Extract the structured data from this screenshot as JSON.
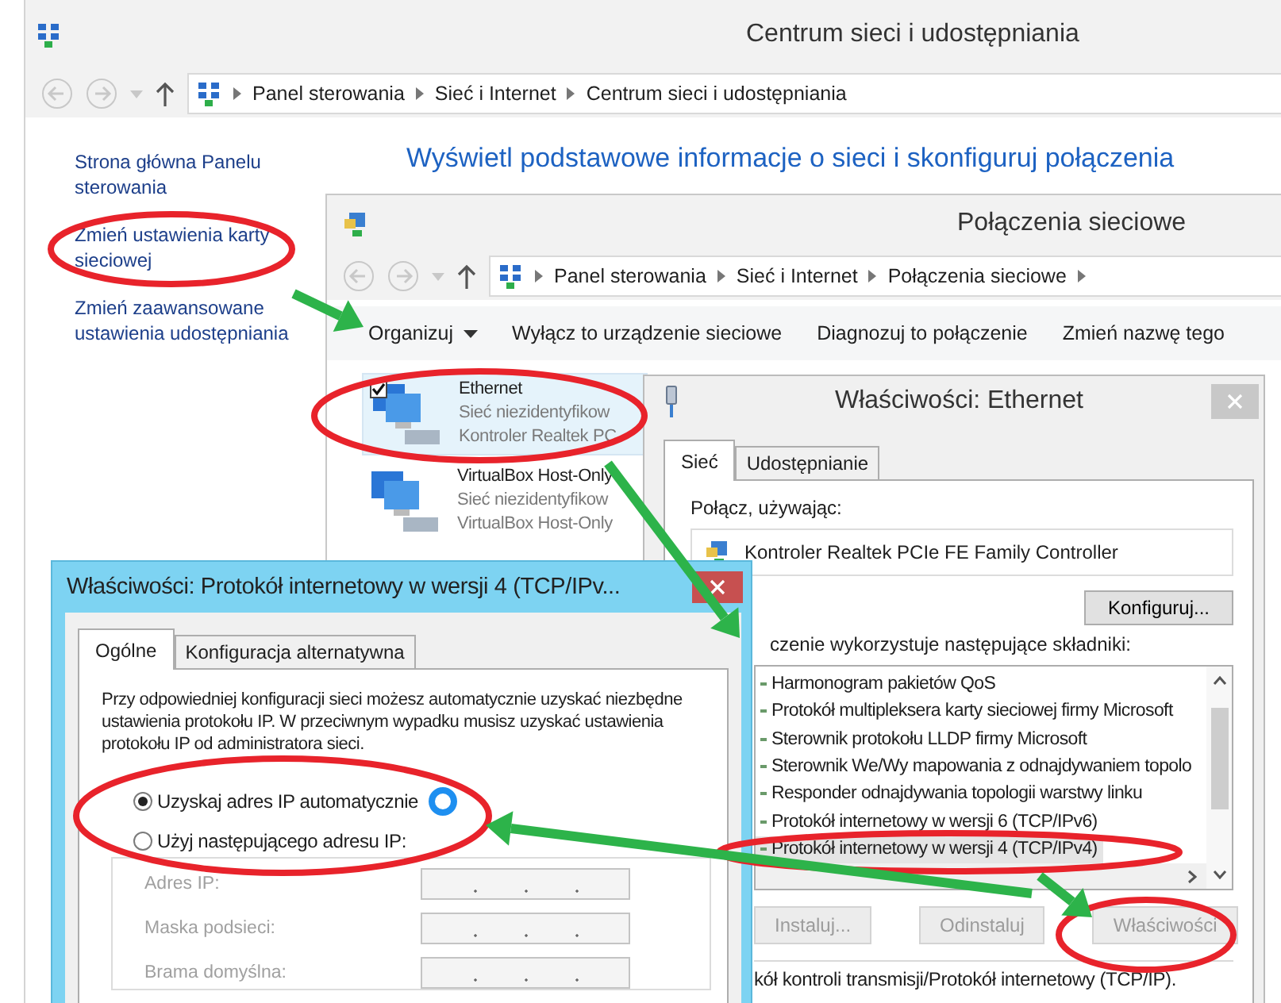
{
  "main_window": {
    "title": "Centrum sieci i udostępniania",
    "breadcrumb": [
      "Panel sterowania",
      "Sieć i Internet",
      "Centrum sieci i udostępniania"
    ],
    "sidebar": {
      "items": [
        {
          "label": "Strona główna Panelu sterowania"
        },
        {
          "label": "Zmień ustawienia karty sieciowej"
        },
        {
          "label": "Zmień zaawansowane ustawienia udostępniania"
        }
      ]
    },
    "heading": "Wyświetl podstawowe informacje o sieci i skonfiguruj połączenia"
  },
  "connections_window": {
    "title": "Połączenia sieciowe",
    "breadcrumb": [
      "Panel sterowania",
      "Sieć i Internet",
      "Połączenia sieciowe"
    ],
    "toolbar": [
      {
        "label": "Organizuj",
        "dropdown": true
      },
      {
        "label": "Wyłącz to urządzenie sieciowe",
        "dropdown": false
      },
      {
        "label": "Diagnozuj to połączenie",
        "dropdown": false
      },
      {
        "label": "Zmień nazwę tego",
        "dropdown": false
      }
    ],
    "connections": [
      {
        "name": "Ethernet",
        "status": "Sieć niezidentyfikow",
        "device": "Kontroler Realtek PC",
        "selected": true,
        "checked": true
      },
      {
        "name": "VirtualBox Host-Only",
        "status": "Sieć niezidentyfikow",
        "device": "VirtualBox Host-Only",
        "selected": false,
        "checked": false
      }
    ]
  },
  "ethernet_window": {
    "title": "Właściwości: Ethernet",
    "tabs": [
      {
        "label": "Sieć",
        "selected": true
      },
      {
        "label": "Udostępnianie",
        "selected": false
      }
    ],
    "connect_using_label": "Połącz, używając:",
    "adapter": "Kontroler Realtek PCIe FE Family Controller",
    "configure_button": "Konfiguruj...",
    "components_label": "czenie wykorzystuje następujące składniki:",
    "components": [
      {
        "name": "Harmonogram pakietów QoS",
        "selected": false
      },
      {
        "name": "Protokół multipleksera karty sieciowej firmy Microsoft",
        "selected": false
      },
      {
        "name": "Sterownik protokołu LLDP firmy Microsoft",
        "selected": false
      },
      {
        "name": "Sterownik We/Wy mapowania z odnajdywaniem topolo",
        "selected": false
      },
      {
        "name": "Responder odnajdywania topologii warstwy linku",
        "selected": false
      },
      {
        "name": "Protokół internetowy w wersji 6 (TCP/IPv6)",
        "selected": false
      },
      {
        "name": "Protokół internetowy w wersji 4 (TCP/IPv4)",
        "selected": true
      }
    ],
    "buttons": [
      {
        "label": "Instaluj...",
        "disabled": true
      },
      {
        "label": "Odinstaluj",
        "disabled": true
      },
      {
        "label": "Właściwości",
        "disabled": true
      }
    ],
    "description": "kół kontroli transmisji/Protokół internetowy (TCP/IP)."
  },
  "ip_window": {
    "title": "Właściwości: Protokół internetowy w wersji 4 (TCP/IPv...",
    "tabs": [
      {
        "label": "Ogólne",
        "selected": true
      },
      {
        "label": "Konfiguracja alternatywna",
        "selected": false
      }
    ],
    "intro": "Przy odpowiedniej konfiguracji sieci możesz automatycznie uzyskać niezbędne ustawienia protokołu IP. W przeciwnym wypadku musisz uzyskać ustawienia protokołu IP od administratora sieci.",
    "options": [
      {
        "label": "Uzyskaj adres IP automatycznie",
        "selected": true
      },
      {
        "label": "Użyj następującego adresu IP:",
        "selected": false
      }
    ],
    "busy_cursor": true,
    "fields": [
      {
        "label": "Adres IP:",
        "disabled": true
      },
      {
        "label": "Maska podsieci:",
        "disabled": true
      },
      {
        "label": "Brama domyślna:",
        "disabled": true
      }
    ]
  }
}
